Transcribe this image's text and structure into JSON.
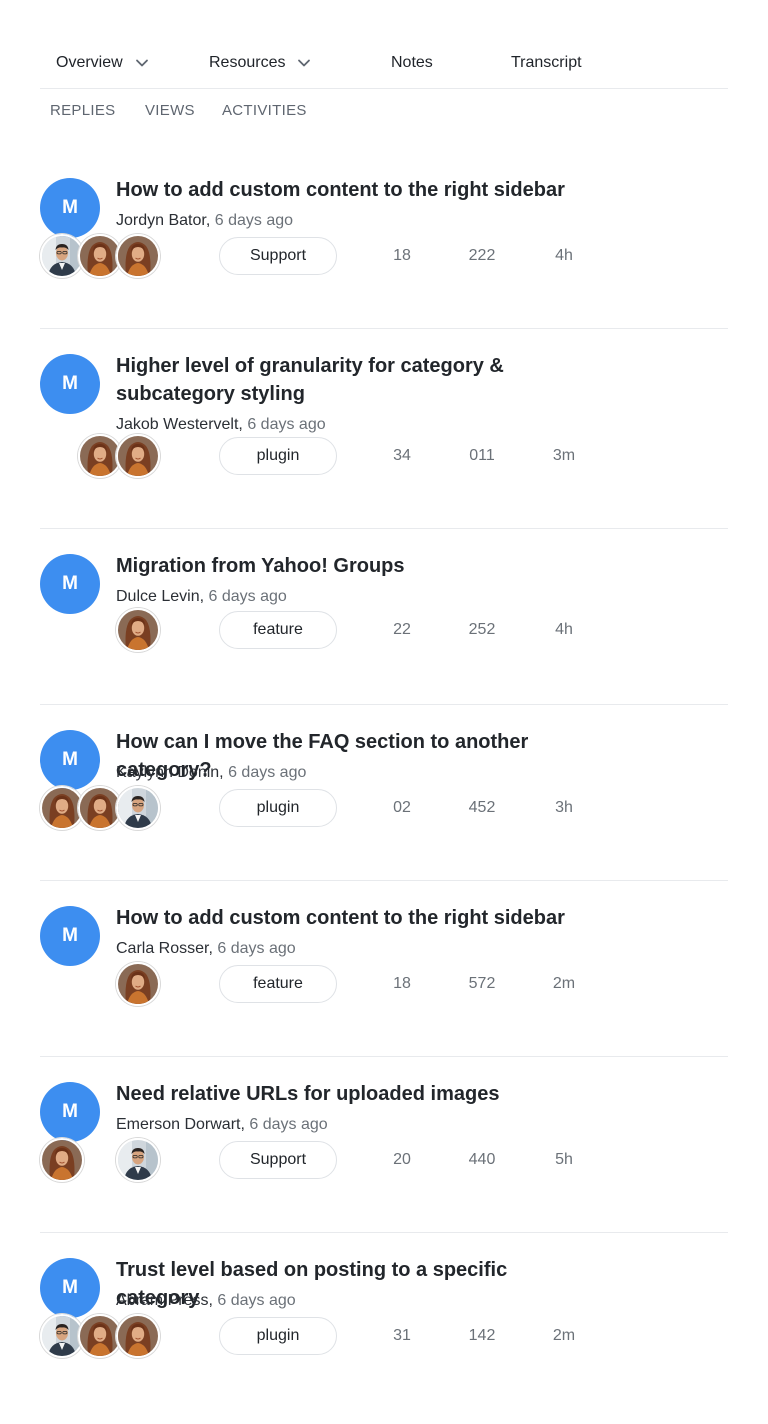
{
  "nav": {
    "items": [
      {
        "label": "Overview",
        "dropdown": true
      },
      {
        "label": "Resources",
        "dropdown": true
      },
      {
        "label": "Notes",
        "dropdown": false
      },
      {
        "label": "Transcript",
        "dropdown": false
      }
    ]
  },
  "subtabs": [
    "REPLIES",
    "VIEWS",
    "ACTIVITIES"
  ],
  "colors": {
    "avatar": "#3d8ef0",
    "border": "#e8eaed",
    "muted": "#6b7178"
  },
  "topics": [
    {
      "avatar_letter": "M",
      "title": "How to add custom content to the right sidebar",
      "author": "Jordyn Bator,",
      "time": "6 days ago",
      "participants": [
        "man",
        "woman",
        "woman"
      ],
      "tag": "Support",
      "replies": "18",
      "views": "222",
      "activity": "4h"
    },
    {
      "avatar_letter": "M",
      "title": "Higher level of granularity for category & subcategory styling",
      "author": "Jakob Westervelt,",
      "time": "6 days ago",
      "participants": [
        "woman",
        "woman"
      ],
      "tag": "plugin",
      "replies": "34",
      "views": "011",
      "activity": "3m"
    },
    {
      "avatar_letter": "M",
      "title": "Migration from Yahoo! Groups",
      "author": "Dulce Levin,",
      "time": "6 days ago",
      "participants": [
        "woman"
      ],
      "tag": "feature",
      "replies": "22",
      "views": "252",
      "activity": "4h"
    },
    {
      "avatar_letter": "M",
      "title": "How can I move the FAQ section to another category?",
      "author": "Kaylynn Donin,",
      "time": "6 days ago",
      "participants": [
        "woman",
        "woman",
        "man"
      ],
      "tag": "plugin",
      "replies": "02",
      "views": "452",
      "activity": "3h"
    },
    {
      "avatar_letter": "M",
      "title": "How to add custom content to the right sidebar",
      "author": "Carla Rosser,",
      "time": "6 days ago",
      "participants": [
        "woman"
      ],
      "tag": "feature",
      "replies": "18",
      "views": "572",
      "activity": "2m"
    },
    {
      "avatar_letter": "M",
      "title": "Need relative URLs for uploaded images",
      "author": "Emerson Dorwart,",
      "time": "6 days ago",
      "participants": [
        "woman",
        "man"
      ],
      "tag": "Support",
      "replies": "20",
      "views": "440",
      "activity": "5h"
    },
    {
      "avatar_letter": "M",
      "title": "Trust level based on posting to a specific category",
      "author": "Abram Press,",
      "time": "6 days ago",
      "participants": [
        "man",
        "woman",
        "woman"
      ],
      "tag": "plugin",
      "replies": "31",
      "views": "142",
      "activity": "2m"
    }
  ]
}
